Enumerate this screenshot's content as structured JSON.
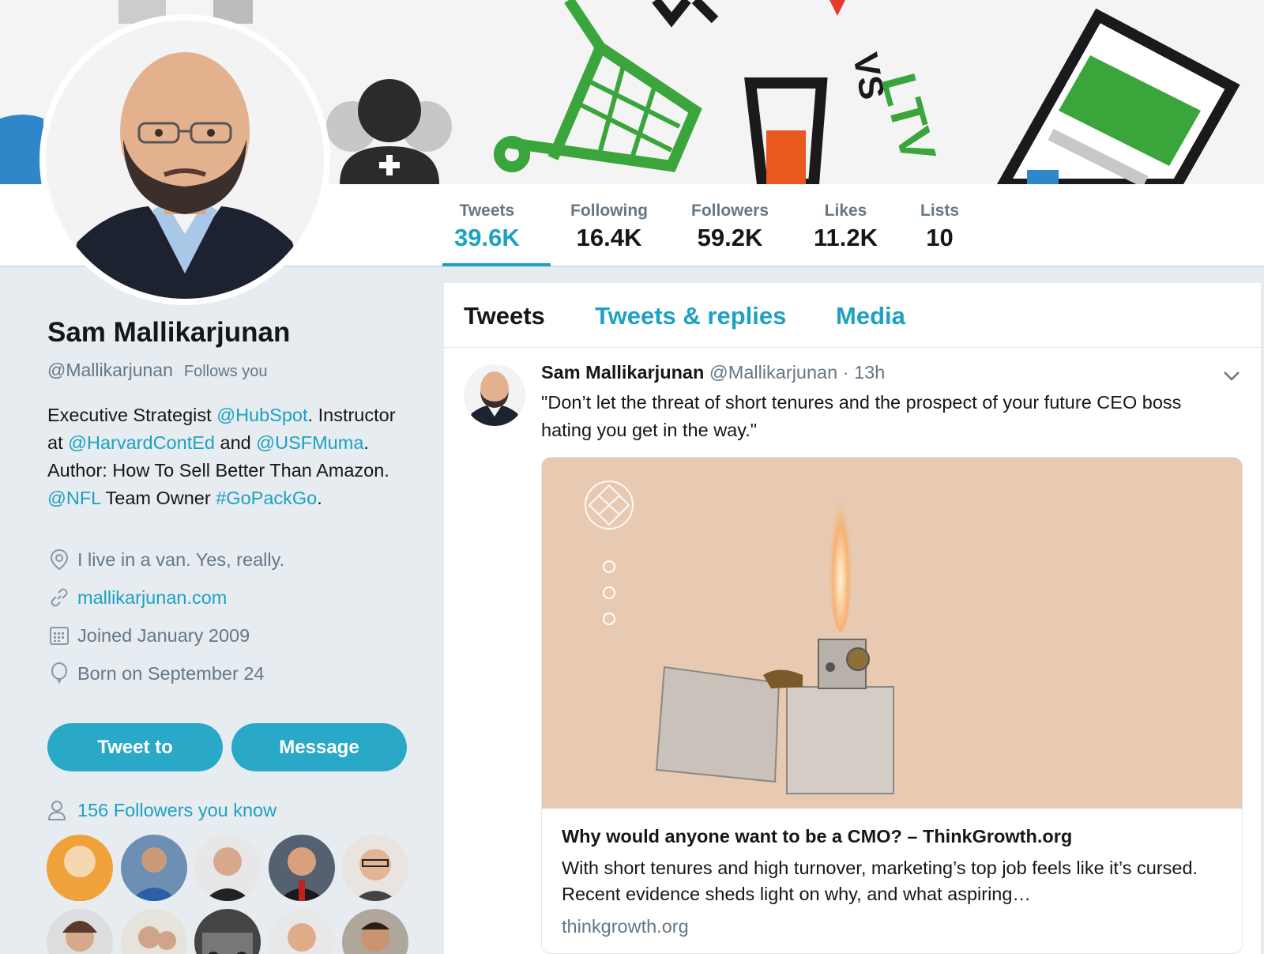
{
  "profile": {
    "name": "Sam Mallikarjunan",
    "handle": "@Mallikarjunan",
    "follows_you": "Follows you",
    "bio": [
      {
        "text": "Executive Strategist ",
        "link": false
      },
      {
        "text": "@HubSpot",
        "link": true
      },
      {
        "text": ". Instructor at ",
        "link": false
      },
      {
        "text": "@HarvardContEd",
        "link": true
      },
      {
        "text": " and ",
        "link": false
      },
      {
        "text": "@USFMuma",
        "link": true
      },
      {
        "text": ". Author: How To Sell Better Than Amazon. ",
        "link": false
      },
      {
        "text": "@NFL",
        "link": true
      },
      {
        "text": " Team Owner ",
        "link": false
      },
      {
        "text": "#GoPackGo",
        "link": true
      },
      {
        "text": ".",
        "link": false
      }
    ],
    "location": "I live in a van. Yes, really.",
    "website": "mallikarjunan.com",
    "joined": "Joined January 2009",
    "born": "Born on September 24",
    "tweet_to_label": "Tweet to",
    "message_label": "Message",
    "followers_you_know": "156 Followers you know"
  },
  "banner": {
    "vs_text": "VS",
    "ltv_text": "LTV"
  },
  "stats": [
    {
      "label": "Tweets",
      "value": "39.6K"
    },
    {
      "label": "Following",
      "value": "16.4K"
    },
    {
      "label": "Followers",
      "value": "59.2K"
    },
    {
      "label": "Likes",
      "value": "11.2K"
    },
    {
      "label": "Lists",
      "value": "10"
    }
  ],
  "tabs": [
    "Tweets",
    "Tweets & replies",
    "Media"
  ],
  "tweet": {
    "author": "Sam Mallikarjunan",
    "handle": "@Mallikarjunan",
    "time": " · 13h",
    "text": "\"Don’t let the threat of short tenures and the prospect of your future CEO boss hating you get in the way.\"",
    "card": {
      "title": "Why would anyone want to be a CMO? – ThinkGrowth.org",
      "description": "With short tenures and high turnover, marketing’s top job feels like it’s cursed. Recent evidence sheds light on why, and what aspiring…",
      "domain": "thinkgrowth.org"
    }
  },
  "colors": {
    "accent": "#1da1c2",
    "button": "#2aa8c8",
    "background": "#e6ecf0"
  }
}
